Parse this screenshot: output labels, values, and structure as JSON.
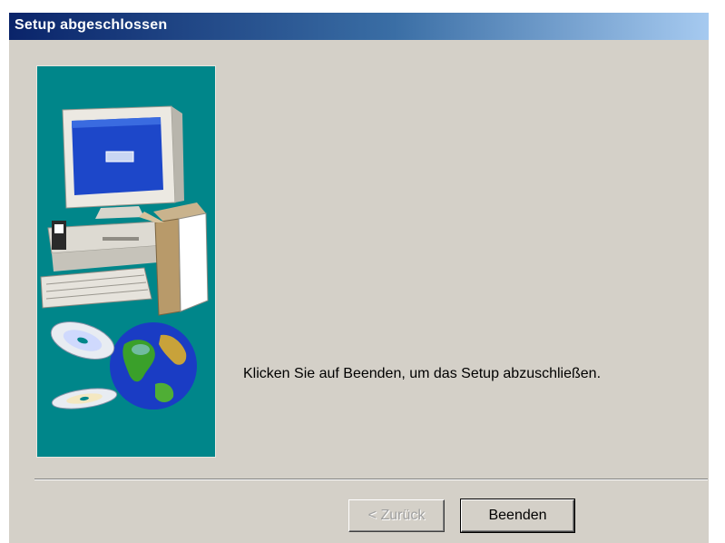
{
  "window": {
    "title": "Setup abgeschlossen"
  },
  "content": {
    "message": "Klicken Sie auf Beenden, um das Setup abzuschließen."
  },
  "buttons": {
    "back_label": "< Zurück",
    "finish_label": "Beenden"
  },
  "colors": {
    "title_bar_start": "#0a246a",
    "title_bar_end": "#a6caf0",
    "dialog_background": "#d4d0c8",
    "side_image_background": "#00868a"
  },
  "icons": {
    "side_image": "computer-with-box-cds-and-globe-illustration"
  }
}
